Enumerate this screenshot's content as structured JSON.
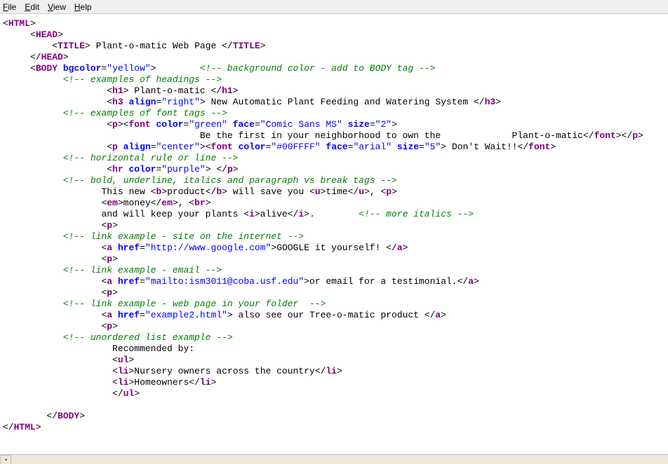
{
  "menubar": {
    "file": "File",
    "edit": "Edit",
    "view": "View",
    "help": "Help"
  },
  "code": {
    "lines": [
      {
        "indent": 0,
        "parts": [
          {
            "c": "punct",
            "t": "<"
          },
          {
            "c": "tag",
            "t": "HTML"
          },
          {
            "c": "punct",
            "t": ">"
          }
        ]
      },
      {
        "indent": 5,
        "parts": [
          {
            "c": "punct",
            "t": "<"
          },
          {
            "c": "tag",
            "t": "HEAD"
          },
          {
            "c": "punct",
            "t": ">"
          }
        ]
      },
      {
        "indent": 9,
        "parts": [
          {
            "c": "punct",
            "t": "<"
          },
          {
            "c": "tag",
            "t": "TITLE"
          },
          {
            "c": "punct",
            "t": "> "
          },
          {
            "c": "txt",
            "t": "Plant-o-matic Web Page "
          },
          {
            "c": "punct",
            "t": "</"
          },
          {
            "c": "tag",
            "t": "TITLE"
          },
          {
            "c": "punct",
            "t": ">"
          }
        ]
      },
      {
        "indent": 5,
        "parts": [
          {
            "c": "punct",
            "t": "</"
          },
          {
            "c": "tag",
            "t": "HEAD"
          },
          {
            "c": "punct",
            "t": ">"
          }
        ]
      },
      {
        "indent": 5,
        "parts": [
          {
            "c": "punct",
            "t": "<"
          },
          {
            "c": "tag",
            "t": "BODY"
          },
          {
            "c": "txt",
            "t": " "
          },
          {
            "c": "attr",
            "t": "bgcolor"
          },
          {
            "c": "punct",
            "t": "="
          },
          {
            "c": "str",
            "t": "\"yellow\""
          },
          {
            "c": "punct",
            "t": ">        "
          },
          {
            "c": "cmt",
            "t": "<!-- background color - add to BODY tag -->"
          }
        ]
      },
      {
        "indent": 11,
        "parts": [
          {
            "c": "cmt",
            "t": "<!-- examples of headings -->"
          }
        ]
      },
      {
        "indent": 19,
        "parts": [
          {
            "c": "punct",
            "t": "<"
          },
          {
            "c": "tag",
            "t": "h1"
          },
          {
            "c": "punct",
            "t": "> "
          },
          {
            "c": "txt",
            "t": "Plant-o-matic "
          },
          {
            "c": "punct",
            "t": "</"
          },
          {
            "c": "tag",
            "t": "h1"
          },
          {
            "c": "punct",
            "t": ">"
          }
        ]
      },
      {
        "indent": 19,
        "parts": [
          {
            "c": "punct",
            "t": "<"
          },
          {
            "c": "tag",
            "t": "h3"
          },
          {
            "c": "txt",
            "t": " "
          },
          {
            "c": "attr",
            "t": "align"
          },
          {
            "c": "punct",
            "t": "="
          },
          {
            "c": "str",
            "t": "\"right\""
          },
          {
            "c": "punct",
            "t": "> "
          },
          {
            "c": "txt",
            "t": "New Automatic Plant Feeding and Watering System "
          },
          {
            "c": "punct",
            "t": "</"
          },
          {
            "c": "tag",
            "t": "h3"
          },
          {
            "c": "punct",
            "t": ">"
          }
        ]
      },
      {
        "indent": 11,
        "parts": [
          {
            "c": "cmt",
            "t": "<!-- examples of font tags -->"
          }
        ]
      },
      {
        "indent": 19,
        "parts": [
          {
            "c": "punct",
            "t": "<"
          },
          {
            "c": "tag",
            "t": "p"
          },
          {
            "c": "punct",
            "t": "><"
          },
          {
            "c": "tag",
            "t": "font"
          },
          {
            "c": "txt",
            "t": " "
          },
          {
            "c": "attr",
            "t": "color"
          },
          {
            "c": "punct",
            "t": "="
          },
          {
            "c": "str",
            "t": "\"green\""
          },
          {
            "c": "txt",
            "t": " "
          },
          {
            "c": "attr",
            "t": "face"
          },
          {
            "c": "punct",
            "t": "="
          },
          {
            "c": "str",
            "t": "\"Comic Sans MS\""
          },
          {
            "c": "txt",
            "t": " "
          },
          {
            "c": "attr",
            "t": "size"
          },
          {
            "c": "punct",
            "t": "="
          },
          {
            "c": "str",
            "t": "\"2\""
          },
          {
            "c": "punct",
            "t": ">"
          }
        ]
      },
      {
        "indent": 36,
        "parts": [
          {
            "c": "txt",
            "t": "Be the first in your neighborhood to own the             Plant-o-matic"
          },
          {
            "c": "punct",
            "t": "</"
          },
          {
            "c": "tag",
            "t": "font"
          },
          {
            "c": "punct",
            "t": "></"
          },
          {
            "c": "tag",
            "t": "p"
          },
          {
            "c": "punct",
            "t": ">"
          }
        ]
      },
      {
        "indent": 19,
        "parts": [
          {
            "c": "punct",
            "t": "<"
          },
          {
            "c": "tag",
            "t": "p"
          },
          {
            "c": "txt",
            "t": " "
          },
          {
            "c": "attr",
            "t": "align"
          },
          {
            "c": "punct",
            "t": "="
          },
          {
            "c": "str",
            "t": "\"center\""
          },
          {
            "c": "punct",
            "t": "><"
          },
          {
            "c": "tag",
            "t": "font"
          },
          {
            "c": "txt",
            "t": " "
          },
          {
            "c": "attr",
            "t": "color"
          },
          {
            "c": "punct",
            "t": "="
          },
          {
            "c": "str",
            "t": "\"#00FFFF\""
          },
          {
            "c": "txt",
            "t": " "
          },
          {
            "c": "attr",
            "t": "face"
          },
          {
            "c": "punct",
            "t": "="
          },
          {
            "c": "str",
            "t": "\"arial\""
          },
          {
            "c": "txt",
            "t": " "
          },
          {
            "c": "attr",
            "t": "size"
          },
          {
            "c": "punct",
            "t": "="
          },
          {
            "c": "str",
            "t": "\"5\""
          },
          {
            "c": "punct",
            "t": "> "
          },
          {
            "c": "txt",
            "t": "Don't Wait!!"
          },
          {
            "c": "punct",
            "t": "</"
          },
          {
            "c": "tag",
            "t": "font"
          },
          {
            "c": "punct",
            "t": ">"
          }
        ]
      },
      {
        "indent": 11,
        "parts": [
          {
            "c": "cmt",
            "t": "<!-- horizontal rule or line -->"
          }
        ]
      },
      {
        "indent": 19,
        "parts": [
          {
            "c": "punct",
            "t": "<"
          },
          {
            "c": "tag",
            "t": "hr"
          },
          {
            "c": "txt",
            "t": " "
          },
          {
            "c": "attr",
            "t": "color"
          },
          {
            "c": "punct",
            "t": "="
          },
          {
            "c": "str",
            "t": "\"purple\""
          },
          {
            "c": "punct",
            "t": "> </"
          },
          {
            "c": "tag",
            "t": "p"
          },
          {
            "c": "punct",
            "t": ">"
          }
        ]
      },
      {
        "indent": 11,
        "parts": [
          {
            "c": "cmt",
            "t": "<!-- bold, underline, italics and paragraph vs break tags -->"
          }
        ]
      },
      {
        "indent": 18,
        "parts": [
          {
            "c": "txt",
            "t": "This new "
          },
          {
            "c": "punct",
            "t": "<"
          },
          {
            "c": "tag",
            "t": "b"
          },
          {
            "c": "punct",
            "t": ">"
          },
          {
            "c": "txt",
            "t": "product"
          },
          {
            "c": "punct",
            "t": "</"
          },
          {
            "c": "tag",
            "t": "b"
          },
          {
            "c": "punct",
            "t": ">"
          },
          {
            "c": "txt",
            "t": " will save you "
          },
          {
            "c": "punct",
            "t": "<"
          },
          {
            "c": "tag",
            "t": "u"
          },
          {
            "c": "punct",
            "t": ">"
          },
          {
            "c": "txt",
            "t": "time"
          },
          {
            "c": "punct",
            "t": "</"
          },
          {
            "c": "tag",
            "t": "u"
          },
          {
            "c": "punct",
            "t": ">, <"
          },
          {
            "c": "tag",
            "t": "p"
          },
          {
            "c": "punct",
            "t": ">"
          }
        ]
      },
      {
        "indent": 18,
        "parts": [
          {
            "c": "punct",
            "t": "<"
          },
          {
            "c": "tag",
            "t": "em"
          },
          {
            "c": "punct",
            "t": ">"
          },
          {
            "c": "txt",
            "t": "money"
          },
          {
            "c": "punct",
            "t": "</"
          },
          {
            "c": "tag",
            "t": "em"
          },
          {
            "c": "punct",
            "t": ">, <"
          },
          {
            "c": "tag",
            "t": "br"
          },
          {
            "c": "punct",
            "t": ">"
          }
        ]
      },
      {
        "indent": 18,
        "parts": [
          {
            "c": "txt",
            "t": "and will keep your plants "
          },
          {
            "c": "punct",
            "t": "<"
          },
          {
            "c": "tag",
            "t": "i"
          },
          {
            "c": "punct",
            "t": ">"
          },
          {
            "c": "txt",
            "t": "alive"
          },
          {
            "c": "punct",
            "t": "</"
          },
          {
            "c": "tag",
            "t": "i"
          },
          {
            "c": "punct",
            "t": ">.        "
          },
          {
            "c": "cmt",
            "t": "<!-- more italics -->"
          }
        ]
      },
      {
        "indent": 18,
        "parts": [
          {
            "c": "punct",
            "t": "<"
          },
          {
            "c": "tag",
            "t": "p"
          },
          {
            "c": "punct",
            "t": ">"
          }
        ]
      },
      {
        "indent": 11,
        "parts": [
          {
            "c": "cmt",
            "t": "<!-- link example - site on the internet -->"
          }
        ]
      },
      {
        "indent": 18,
        "parts": [
          {
            "c": "punct",
            "t": "<"
          },
          {
            "c": "tag",
            "t": "a"
          },
          {
            "c": "txt",
            "t": " "
          },
          {
            "c": "attr",
            "t": "href"
          },
          {
            "c": "punct",
            "t": "="
          },
          {
            "c": "str",
            "t": "\"http://www.google.com\""
          },
          {
            "c": "punct",
            "t": ">"
          },
          {
            "c": "txt",
            "t": "GOOGLE it yourself! "
          },
          {
            "c": "punct",
            "t": "</"
          },
          {
            "c": "tag",
            "t": "a"
          },
          {
            "c": "punct",
            "t": ">"
          }
        ]
      },
      {
        "indent": 18,
        "parts": [
          {
            "c": "punct",
            "t": "<"
          },
          {
            "c": "tag",
            "t": "p"
          },
          {
            "c": "punct",
            "t": ">"
          }
        ]
      },
      {
        "indent": 11,
        "parts": [
          {
            "c": "cmt",
            "t": "<!-- link example - email -->"
          }
        ]
      },
      {
        "indent": 18,
        "parts": [
          {
            "c": "punct",
            "t": "<"
          },
          {
            "c": "tag",
            "t": "a"
          },
          {
            "c": "txt",
            "t": " "
          },
          {
            "c": "attr",
            "t": "href"
          },
          {
            "c": "punct",
            "t": "="
          },
          {
            "c": "str",
            "t": "\"mailto:ism3011@coba.usf.edu\""
          },
          {
            "c": "punct",
            "t": ">"
          },
          {
            "c": "txt",
            "t": "or email for a testimonial."
          },
          {
            "c": "punct",
            "t": "</"
          },
          {
            "c": "tag",
            "t": "a"
          },
          {
            "c": "punct",
            "t": ">"
          }
        ]
      },
      {
        "indent": 18,
        "parts": [
          {
            "c": "punct",
            "t": "<"
          },
          {
            "c": "tag",
            "t": "p"
          },
          {
            "c": "punct",
            "t": ">"
          }
        ]
      },
      {
        "indent": 11,
        "parts": [
          {
            "c": "cmt",
            "t": "<!-- link example - web page in your folder  -->"
          }
        ]
      },
      {
        "indent": 18,
        "parts": [
          {
            "c": "punct",
            "t": "<"
          },
          {
            "c": "tag",
            "t": "a"
          },
          {
            "c": "txt",
            "t": " "
          },
          {
            "c": "attr",
            "t": "href"
          },
          {
            "c": "punct",
            "t": "="
          },
          {
            "c": "str",
            "t": "\"example2.html\""
          },
          {
            "c": "punct",
            "t": "> "
          },
          {
            "c": "txt",
            "t": "also see our Tree-o-matic product "
          },
          {
            "c": "punct",
            "t": "</"
          },
          {
            "c": "tag",
            "t": "a"
          },
          {
            "c": "punct",
            "t": ">"
          }
        ]
      },
      {
        "indent": 18,
        "parts": [
          {
            "c": "punct",
            "t": "<"
          },
          {
            "c": "tag",
            "t": "p"
          },
          {
            "c": "punct",
            "t": ">"
          }
        ]
      },
      {
        "indent": 11,
        "parts": [
          {
            "c": "cmt",
            "t": "<!-- unordered list example -->"
          }
        ]
      },
      {
        "indent": 20,
        "parts": [
          {
            "c": "txt",
            "t": "Recommended by:"
          }
        ]
      },
      {
        "indent": 20,
        "parts": [
          {
            "c": "punct",
            "t": "<"
          },
          {
            "c": "tag",
            "t": "ul"
          },
          {
            "c": "punct",
            "t": ">"
          }
        ]
      },
      {
        "indent": 20,
        "parts": [
          {
            "c": "punct",
            "t": "<"
          },
          {
            "c": "tag",
            "t": "li"
          },
          {
            "c": "punct",
            "t": ">"
          },
          {
            "c": "txt",
            "t": "Nursery owners across the country"
          },
          {
            "c": "punct",
            "t": "</"
          },
          {
            "c": "tag",
            "t": "li"
          },
          {
            "c": "punct",
            "t": ">"
          }
        ]
      },
      {
        "indent": 20,
        "parts": [
          {
            "c": "punct",
            "t": "<"
          },
          {
            "c": "tag",
            "t": "li"
          },
          {
            "c": "punct",
            "t": ">"
          },
          {
            "c": "txt",
            "t": "Homeowners"
          },
          {
            "c": "punct",
            "t": "</"
          },
          {
            "c": "tag",
            "t": "li"
          },
          {
            "c": "punct",
            "t": ">"
          }
        ]
      },
      {
        "indent": 20,
        "parts": [
          {
            "c": "punct",
            "t": "</"
          },
          {
            "c": "tag",
            "t": "ul"
          },
          {
            "c": "punct",
            "t": ">"
          }
        ]
      },
      {
        "indent": 0,
        "parts": []
      },
      {
        "indent": 8,
        "parts": [
          {
            "c": "punct",
            "t": "</"
          },
          {
            "c": "tag",
            "t": "BODY"
          },
          {
            "c": "punct",
            "t": ">"
          }
        ]
      },
      {
        "indent": 0,
        "parts": [
          {
            "c": "punct",
            "t": "</"
          },
          {
            "c": "tag",
            "t": "HTML"
          },
          {
            "c": "punct",
            "t": ">"
          }
        ]
      }
    ]
  }
}
